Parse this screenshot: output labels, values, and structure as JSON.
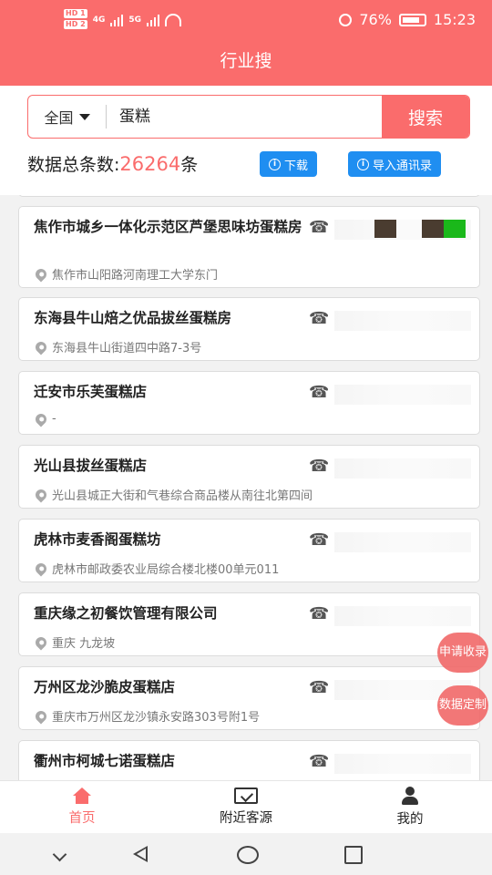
{
  "status_bar": {
    "sim1": "HD 1",
    "sim2": "HD 2",
    "network1": "4G",
    "network2": "5G",
    "battery": "76%",
    "time": "15:23"
  },
  "header": {
    "title": "行业搜"
  },
  "search": {
    "region": "全国",
    "query": "蛋糕",
    "button_label": "搜索"
  },
  "summary": {
    "prefix": "数据总条数:",
    "count": "26264",
    "suffix": "条",
    "download_label": "下载",
    "import_label": "导入通讯录"
  },
  "results": [
    {
      "name": "焦作市城乡一体化示范区芦堡思味坊蛋糕房",
      "address": "焦作市山阳路河南理工大学东门"
    },
    {
      "name": "东海县牛山焙之优品拔丝蛋糕房",
      "address": "东海县牛山街道四中路7-3号"
    },
    {
      "name": "迁安市乐芙蛋糕店",
      "address": "-"
    },
    {
      "name": "光山县拔丝蛋糕店",
      "address": "光山县城正大街和气巷综合商品楼从南往北第四间"
    },
    {
      "name": "虎林市麦香阁蛋糕坊",
      "address": "虎林市邮政委农业局综合楼北楼00单元011"
    },
    {
      "name": "重庆缘之初餐饮管理有限公司",
      "address": "重庆 九龙坡"
    },
    {
      "name": "万州区龙沙脆皮蛋糕店",
      "address": "重庆市万州区龙沙镇永安路303号附1号"
    },
    {
      "name": "衢州市柯城七诺蛋糕店",
      "address": ""
    }
  ],
  "float_buttons": {
    "apply_include": "申请收录",
    "data_custom": "数据定制"
  },
  "tabs": [
    {
      "label": "首页",
      "icon": "home-icon",
      "active": true
    },
    {
      "label": "附近客源",
      "icon": "nearby-icon",
      "active": false
    },
    {
      "label": "我的",
      "icon": "profile-icon",
      "active": false
    }
  ],
  "colors": {
    "brand": "#fa6c6c",
    "accent_blue": "#1f8ef1"
  }
}
